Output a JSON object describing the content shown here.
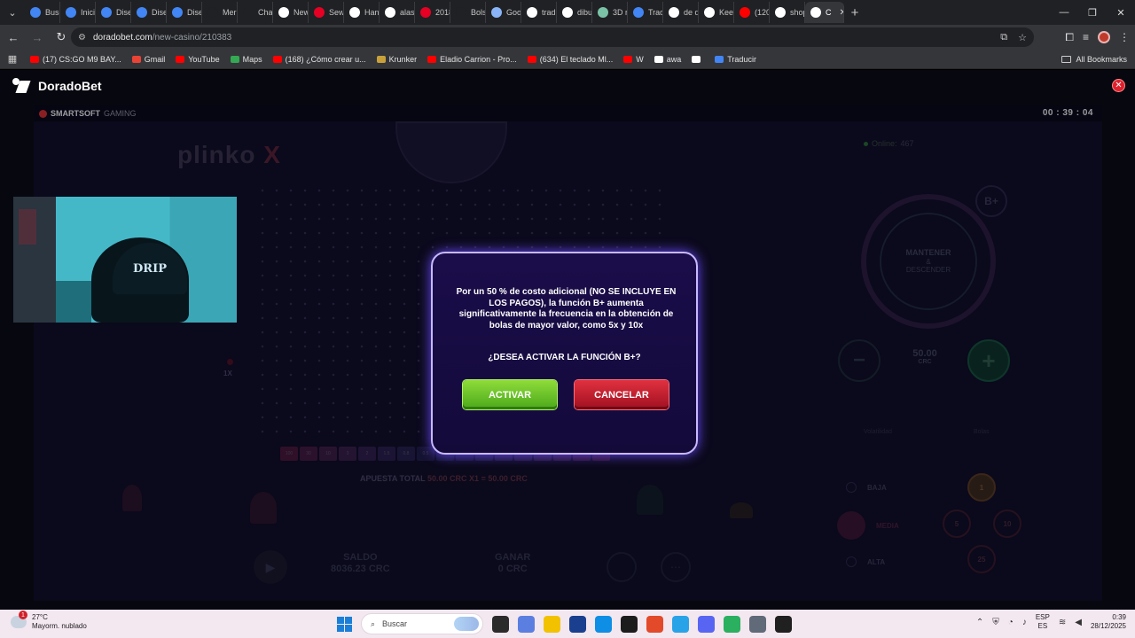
{
  "browser": {
    "tabs": [
      {
        "label": "Busc",
        "color": "#4285f4"
      },
      {
        "label": "Inici",
        "color": "#4285f4"
      },
      {
        "label": "Dise",
        "color": "#4285f4"
      },
      {
        "label": "Dise",
        "color": "#4285f4"
      },
      {
        "label": "Dise",
        "color": "#4285f4"
      },
      {
        "label": "Meri",
        "color": "#202124"
      },
      {
        "label": "Chat",
        "color": "#202124"
      },
      {
        "label": "New",
        "color": "#ffffff"
      },
      {
        "label": "Sewi",
        "color": "#e60023"
      },
      {
        "label": "Han",
        "color": "#ffffff"
      },
      {
        "label": "alas",
        "color": "#ffffff"
      },
      {
        "label": "2018",
        "color": "#e60023"
      },
      {
        "label": "Bols",
        "color": "#202124"
      },
      {
        "label": "Goo",
        "color": "#8ab4f8"
      },
      {
        "label": "tradi",
        "color": "#ffffff"
      },
      {
        "label": "dibu",
        "color": "#ffffff"
      },
      {
        "label": "3D n",
        "color": "#7ac3a6"
      },
      {
        "label": "Tradi",
        "color": "#4285f4"
      },
      {
        "label": "de q",
        "color": "#ffffff"
      },
      {
        "label": "Keep",
        "color": "#ffffff"
      },
      {
        "label": "(120",
        "color": "#ff0000"
      },
      {
        "label": "shop",
        "color": "#ffffff"
      },
      {
        "label": "C",
        "color": "#ffffff"
      }
    ],
    "url_host": "doradobet.com",
    "url_path": "/new-casino/210383",
    "bookmarks": [
      {
        "label": "(17) CS:GO M9 BAY...",
        "color": "#ff0000"
      },
      {
        "label": "Gmail",
        "color": "#ea4335"
      },
      {
        "label": "YouTube",
        "color": "#ff0000"
      },
      {
        "label": "Maps",
        "color": "#34a853"
      },
      {
        "label": "(168) ¿Cómo crear u...",
        "color": "#ff0000"
      },
      {
        "label": "Krunker",
        "color": "#c9a13b"
      },
      {
        "label": "Eladio Carrion - Pro...",
        "color": "#ff0000"
      },
      {
        "label": "(634) El teclado Ml...",
        "color": "#ff0000"
      },
      {
        "label": "W",
        "color": "#ff0000"
      },
      {
        "label": "awa",
        "color": "#ffffff"
      },
      {
        "label": "",
        "color": "#ffffff"
      },
      {
        "label": "Traducir",
        "color": "#4285f4"
      }
    ],
    "all_bookmarks": "All Bookmarks"
  },
  "site": {
    "brand": "DoradoBet",
    "provider_name": "SMARTSOFT",
    "provider_suffix": "GAMING",
    "timer": "00 : 39 : 04"
  },
  "game": {
    "title_a": "plinko",
    "title_b": "X",
    "online_label": "Online:",
    "online_count": "467",
    "bplus": "B+",
    "hold_line1": "MANTENER",
    "hold_line2": "&",
    "hold_line3": "DESCENDER",
    "bet_value": "50.00",
    "bet_currency": "CRC",
    "minus": "−",
    "plus": "+",
    "col_risk": "Volatilidad",
    "col_balls": "Bolas",
    "risk_low": "BAJA",
    "risk_mid": "MEDIA",
    "risk_high": "ALTA",
    "balls": [
      "1",
      "5",
      "10",
      "25"
    ],
    "bet_total_label": "APUESTA TOTAL",
    "bet_total_amount": "50.00 CRC X1",
    "bet_total_result": "= 50.00 CRC",
    "marker_1x": "1X",
    "saldo_label": "SALDO",
    "saldo_value": "8036.23 CRC",
    "ganar_label": "GANAR",
    "ganar_value": "0 CRC",
    "multipliers": [
      "100",
      "30",
      "10",
      "3",
      "2",
      "1.5",
      "0.8",
      "0.5",
      "0.3",
      "0.5",
      "0.8",
      "1.5",
      "2",
      "3",
      "10",
      "30",
      "100"
    ],
    "multiplier_colors": [
      "#b02a5a",
      "#a0306a",
      "#903a78",
      "#7f3f84",
      "#6a3f8c",
      "#5a4090",
      "#4b3f90",
      "#3d3d8a",
      "#363a82",
      "#3d3d8a",
      "#4b3f90",
      "#5a4090",
      "#6a3f8c",
      "#7f3f84",
      "#903a78",
      "#a0306a",
      "#b02a5a"
    ]
  },
  "modal": {
    "message": "Por un 50 % de costo adicional (NO SE INCLUYE EN LOS PAGOS), la función B+ aumenta significativamente la frecuencia en la obtención de bolas de mayor valor, como 5x y 10x",
    "question": "¿DESEA ACTIVAR LA FUNCIÓN B+?",
    "activate": "ACTIVAR",
    "cancel": "CANCELAR"
  },
  "webcam": {
    "cap_text": "DRIP"
  },
  "taskbar": {
    "weather_temp": "27°C",
    "weather_desc": "Mayorm. nublado",
    "weather_badge": "1",
    "search_placeholder": "Buscar",
    "lang_top": "ESP",
    "lang_bottom": "ES",
    "time": "0:39",
    "date": "28/12/2025",
    "app_colors": [
      "#2b2b2b",
      "#5b7fe0",
      "#f2c200",
      "#1a3f8f",
      "#0f8ee6",
      "#1c1c1c",
      "#e24a2a",
      "#29a3e8",
      "#5865f2",
      "#2ab05f",
      "#606a78",
      "#202020"
    ]
  }
}
